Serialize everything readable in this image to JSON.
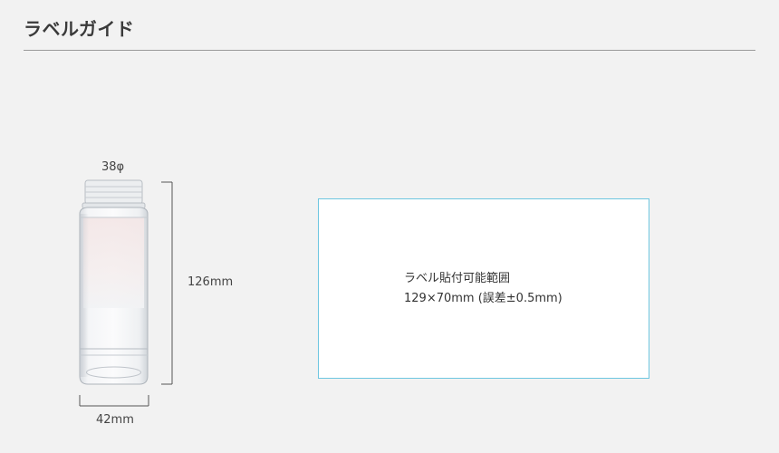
{
  "header": {
    "title": "ラベルガイド"
  },
  "bottle": {
    "diameter_label": "38φ",
    "height_label": "126mm",
    "width_label": "42mm"
  },
  "label_area": {
    "line1": "ラベル貼付可能範囲",
    "line2": "129×70mm (誤差±0.5mm)"
  },
  "colors": {
    "background": "#f2f2f2",
    "label_border": "#6ec6e0",
    "rule": "#9a9a9a"
  }
}
